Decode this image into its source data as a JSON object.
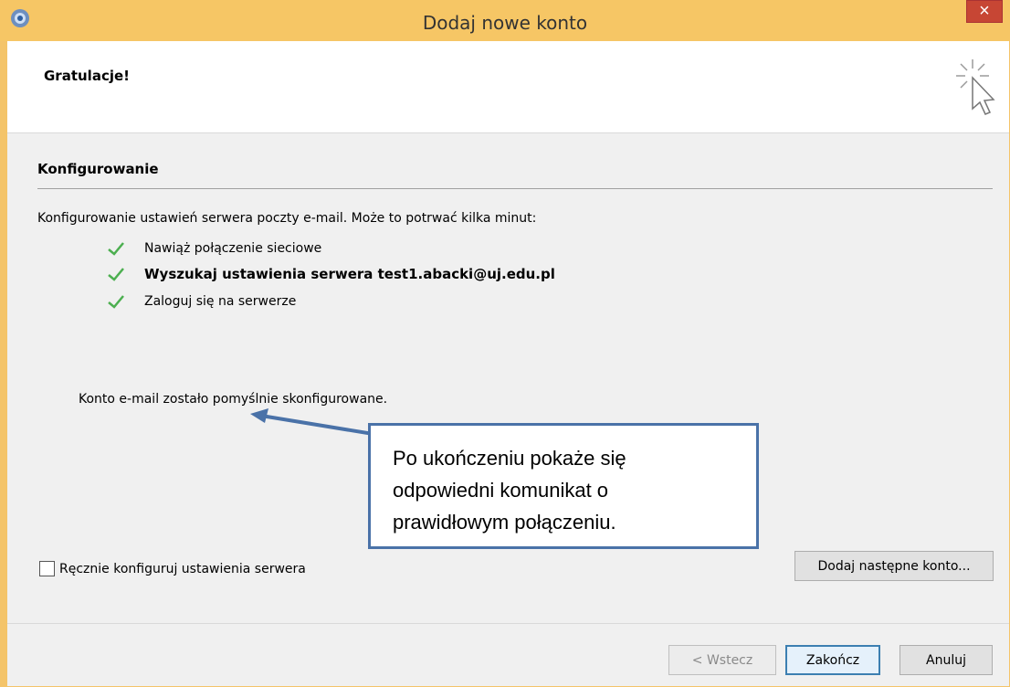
{
  "window": {
    "title": "Dodaj nowe konto",
    "close_glyph": "×"
  },
  "header": {
    "heading": "Gratulacje!",
    "icon": "cursor-sparkle-icon"
  },
  "section": {
    "title": "Konfigurowanie",
    "description": "Konfigurowanie ustawień serwera poczty e-mail. Może to potrwać kilka minut:"
  },
  "steps": [
    {
      "label": "Nawiąż połączenie sieciowe",
      "status": "done",
      "bold": false
    },
    {
      "label": "Wyszukaj ustawienia serwera test1.abacki@uj.edu.pl",
      "status": "done",
      "bold": true
    },
    {
      "label": "Zaloguj się na serwerze",
      "status": "done",
      "bold": false
    }
  ],
  "success_message": "Konto e-mail zostało pomyślnie skonfigurowane.",
  "callout": {
    "lines": [
      "Po ukończeniu pokaże się",
      "odpowiedni komunikat o",
      "prawidłowym połączeniu."
    ]
  },
  "manual_config": {
    "label": "Ręcznie konfiguruj ustawienia serwera",
    "checked": false
  },
  "buttons": {
    "add_next": "Dodaj następne konto...",
    "back": "< Wstecz",
    "finish": "Zakończ",
    "cancel": "Anuluj"
  },
  "colors": {
    "titlebar": "#f6c665",
    "close": "#c74634",
    "callout_border": "#4a72a8",
    "check": "#4caf50"
  }
}
